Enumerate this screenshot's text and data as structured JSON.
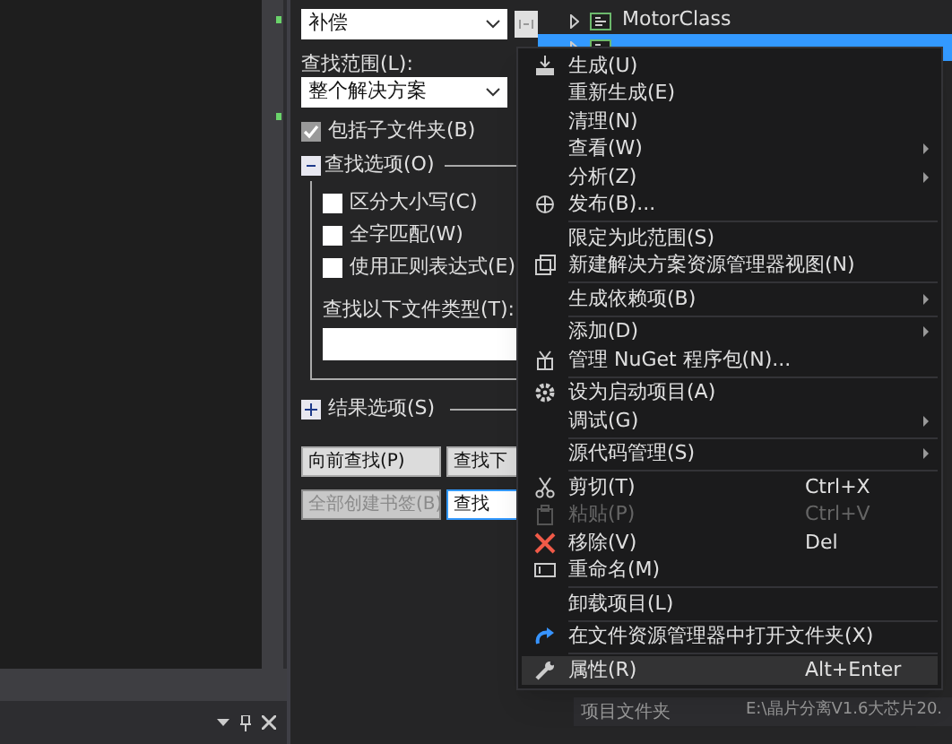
{
  "find_panel": {
    "search_combo": {
      "value": "补偿"
    },
    "scope_label": "查找范围(L):",
    "scope_combo": {
      "value": "整个解决方案"
    },
    "include_subfolders": {
      "label": "包括子文件夹(B)",
      "checked": true
    },
    "find_options": {
      "title": "查找选项(O)",
      "expanded": true,
      "options": [
        {
          "label": "区分大小写(C)",
          "checked": false
        },
        {
          "label": "全字匹配(W)",
          "checked": false
        },
        {
          "label": "使用正则表达式(E)",
          "checked": false
        }
      ],
      "file_types_label": "查找以下文件类型(T):"
    },
    "result_options": {
      "title": "结果选项(S)",
      "expanded": false
    },
    "buttons": [
      {
        "label": "向前查找(P)",
        "disabled": false,
        "focused": false
      },
      {
        "label": "查找下",
        "disabled": false,
        "focused": false
      },
      {
        "label": "全部创建书签(B)",
        "disabled": true,
        "focused": false
      },
      {
        "label": "查找",
        "disabled": false,
        "focused": true
      }
    ]
  },
  "solution_tree": [
    {
      "label": "MotorClass",
      "selected": false
    },
    {
      "selected": true
    }
  ],
  "properties_row": {
    "name": "项目文件夹",
    "value": "E:\\晶片分离V1.6大芯片20."
  },
  "context_menu": [
    {
      "kind": "item",
      "label": "生成(U)",
      "submenu": false,
      "disabled": false,
      "selected": false
    },
    {
      "kind": "item",
      "label": "重新生成(E)",
      "submenu": false,
      "disabled": false,
      "selected": false
    },
    {
      "kind": "item",
      "label": "清理(N)",
      "submenu": false,
      "disabled": false,
      "selected": false
    },
    {
      "kind": "item",
      "label": "查看(W)",
      "submenu": true,
      "disabled": false,
      "selected": false
    },
    {
      "kind": "item",
      "label": "分析(Z)",
      "submenu": true,
      "disabled": false,
      "selected": false
    },
    {
      "kind": "item",
      "label": "发布(B)...",
      "submenu": false,
      "disabled": false,
      "selected": false
    },
    {
      "kind": "separator"
    },
    {
      "kind": "item",
      "label": "限定为此范围(S)",
      "submenu": false,
      "disabled": false,
      "selected": false
    },
    {
      "kind": "item",
      "label": "新建解决方案资源管理器视图(N)",
      "submenu": false,
      "disabled": false,
      "selected": false
    },
    {
      "kind": "separator"
    },
    {
      "kind": "item",
      "label": "生成依赖项(B)",
      "submenu": true,
      "disabled": false,
      "selected": false
    },
    {
      "kind": "separator"
    },
    {
      "kind": "item",
      "label": "添加(D)",
      "submenu": true,
      "disabled": false,
      "selected": false
    },
    {
      "kind": "item",
      "label": "管理 NuGet 程序包(N)...",
      "submenu": false,
      "disabled": false,
      "selected": false
    },
    {
      "kind": "separator"
    },
    {
      "kind": "item",
      "label": "设为启动项目(A)",
      "submenu": false,
      "disabled": false,
      "selected": false
    },
    {
      "kind": "item",
      "label": "调试(G)",
      "submenu": true,
      "disabled": false,
      "selected": false
    },
    {
      "kind": "separator"
    },
    {
      "kind": "item",
      "label": "源代码管理(S)",
      "submenu": true,
      "disabled": false,
      "selected": false
    },
    {
      "kind": "separator"
    },
    {
      "kind": "item",
      "label": "剪切(T)",
      "shortcut": "Ctrl+X",
      "submenu": false,
      "disabled": false,
      "selected": false
    },
    {
      "kind": "item",
      "label": "粘贴(P)",
      "shortcut": "Ctrl+V",
      "submenu": false,
      "disabled": true,
      "selected": false
    },
    {
      "kind": "item",
      "label": "移除(V)",
      "shortcut": "Del",
      "submenu": false,
      "disabled": false,
      "selected": false
    },
    {
      "kind": "item",
      "label": "重命名(M)",
      "submenu": false,
      "disabled": false,
      "selected": false
    },
    {
      "kind": "separator"
    },
    {
      "kind": "item",
      "label": "卸载项目(L)",
      "submenu": false,
      "disabled": false,
      "selected": false
    },
    {
      "kind": "separator"
    },
    {
      "kind": "item",
      "label": "在文件资源管理器中打开文件夹(X)",
      "submenu": false,
      "disabled": false,
      "selected": false
    },
    {
      "kind": "separator"
    },
    {
      "kind": "item",
      "label": "属性(R)",
      "shortcut": "Alt+Enter",
      "submenu": false,
      "disabled": false,
      "selected": true
    }
  ]
}
